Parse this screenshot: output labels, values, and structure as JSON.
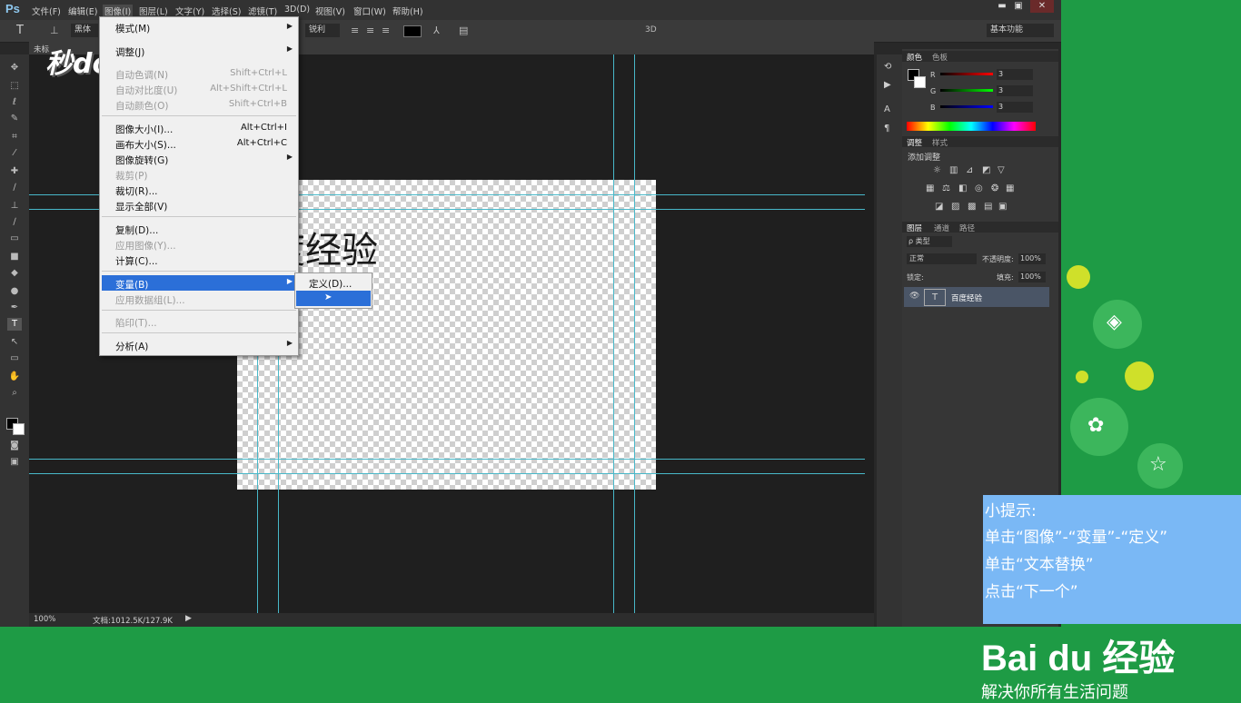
{
  "app": {
    "logo": "Ps",
    "menus": [
      "文件(F)",
      "编辑(E)",
      "图像(I)",
      "图层(L)",
      "文字(Y)",
      "选择(S)",
      "滤镜(T)",
      "3D(D)",
      "视图(V)",
      "窗口(W)",
      "帮助(H)"
    ],
    "active_menu": "图像(I)"
  },
  "window_controls": {
    "minimize": "▬",
    "restore": "▣",
    "close": "✕"
  },
  "options": {
    "tool_glyph": "T",
    "font": "黑体",
    "aa": "锐利",
    "mode3d": "3D",
    "workspace": "基本功能"
  },
  "doc_tab": "未标",
  "watermark": "秒dong视频",
  "canvas_text": "度经验",
  "image_menu": {
    "items": [
      {
        "label": "模式(M)",
        "shortcut": "",
        "disabled": false,
        "submenu": true
      },
      {
        "label": "调整(J)",
        "shortcut": "",
        "disabled": false,
        "submenu": true
      },
      {
        "label": "自动色调(N)",
        "shortcut": "Shift+Ctrl+L",
        "disabled": true
      },
      {
        "label": "自动对比度(U)",
        "shortcut": "Alt+Shift+Ctrl+L",
        "disabled": true
      },
      {
        "label": "自动颜色(O)",
        "shortcut": "Shift+Ctrl+B",
        "disabled": true
      },
      {
        "label": "图像大小(I)...",
        "shortcut": "Alt+Ctrl+I",
        "disabled": false
      },
      {
        "label": "画布大小(S)...",
        "shortcut": "Alt+Ctrl+C",
        "disabled": false
      },
      {
        "label": "图像旋转(G)",
        "shortcut": "",
        "disabled": false,
        "submenu": true
      },
      {
        "label": "裁剪(P)",
        "shortcut": "",
        "disabled": true
      },
      {
        "label": "裁切(R)...",
        "shortcut": "",
        "disabled": false
      },
      {
        "label": "显示全部(V)",
        "shortcut": "",
        "disabled": false
      },
      {
        "label": "复制(D)...",
        "shortcut": "",
        "disabled": false
      },
      {
        "label": "应用图像(Y)...",
        "shortcut": "",
        "disabled": true
      },
      {
        "label": "计算(C)...",
        "shortcut": "",
        "disabled": false
      },
      {
        "label": "变量(B)",
        "shortcut": "",
        "disabled": false,
        "submenu": true,
        "highlighted": true
      },
      {
        "label": "应用数据组(L)...",
        "shortcut": "",
        "disabled": true
      },
      {
        "label": "陷印(T)...",
        "shortcut": "",
        "disabled": true
      },
      {
        "label": "分析(A)",
        "shortcut": "",
        "disabled": false,
        "submenu": true
      }
    ]
  },
  "variable_submenu": {
    "items": [
      "定义(D)...",
      ""
    ]
  },
  "panels": {
    "color_tabs": [
      "颜色",
      "色板"
    ],
    "rgb": [
      {
        "ch": "R",
        "val": "3"
      },
      {
        "ch": "G",
        "val": "3"
      },
      {
        "ch": "B",
        "val": "3"
      }
    ],
    "adjust_tabs": [
      "调整",
      "样式"
    ],
    "adjust_title": "添加调整",
    "layer_tabs": [
      "图层",
      "通道",
      "路径"
    ],
    "layer_filter": "ρ 类型",
    "blend_mode": "正常",
    "opacity_label": "不透明度:",
    "opacity": "100%",
    "lock_label": "锁定:",
    "fill_label": "填充:",
    "fill": "100%",
    "layer_name": "百度经验"
  },
  "status": {
    "zoom": "100%",
    "doc": "文档:1012.5K/127.9K"
  },
  "tips": {
    "title": "小提示:",
    "lines": [
      "单击“图像”-“变量”-“定义”",
      "单击“文本替换”",
      "点击“下一个”"
    ]
  },
  "brand": {
    "logo": "Bai du 经验",
    "slogan": "解决你所有生活问题"
  }
}
